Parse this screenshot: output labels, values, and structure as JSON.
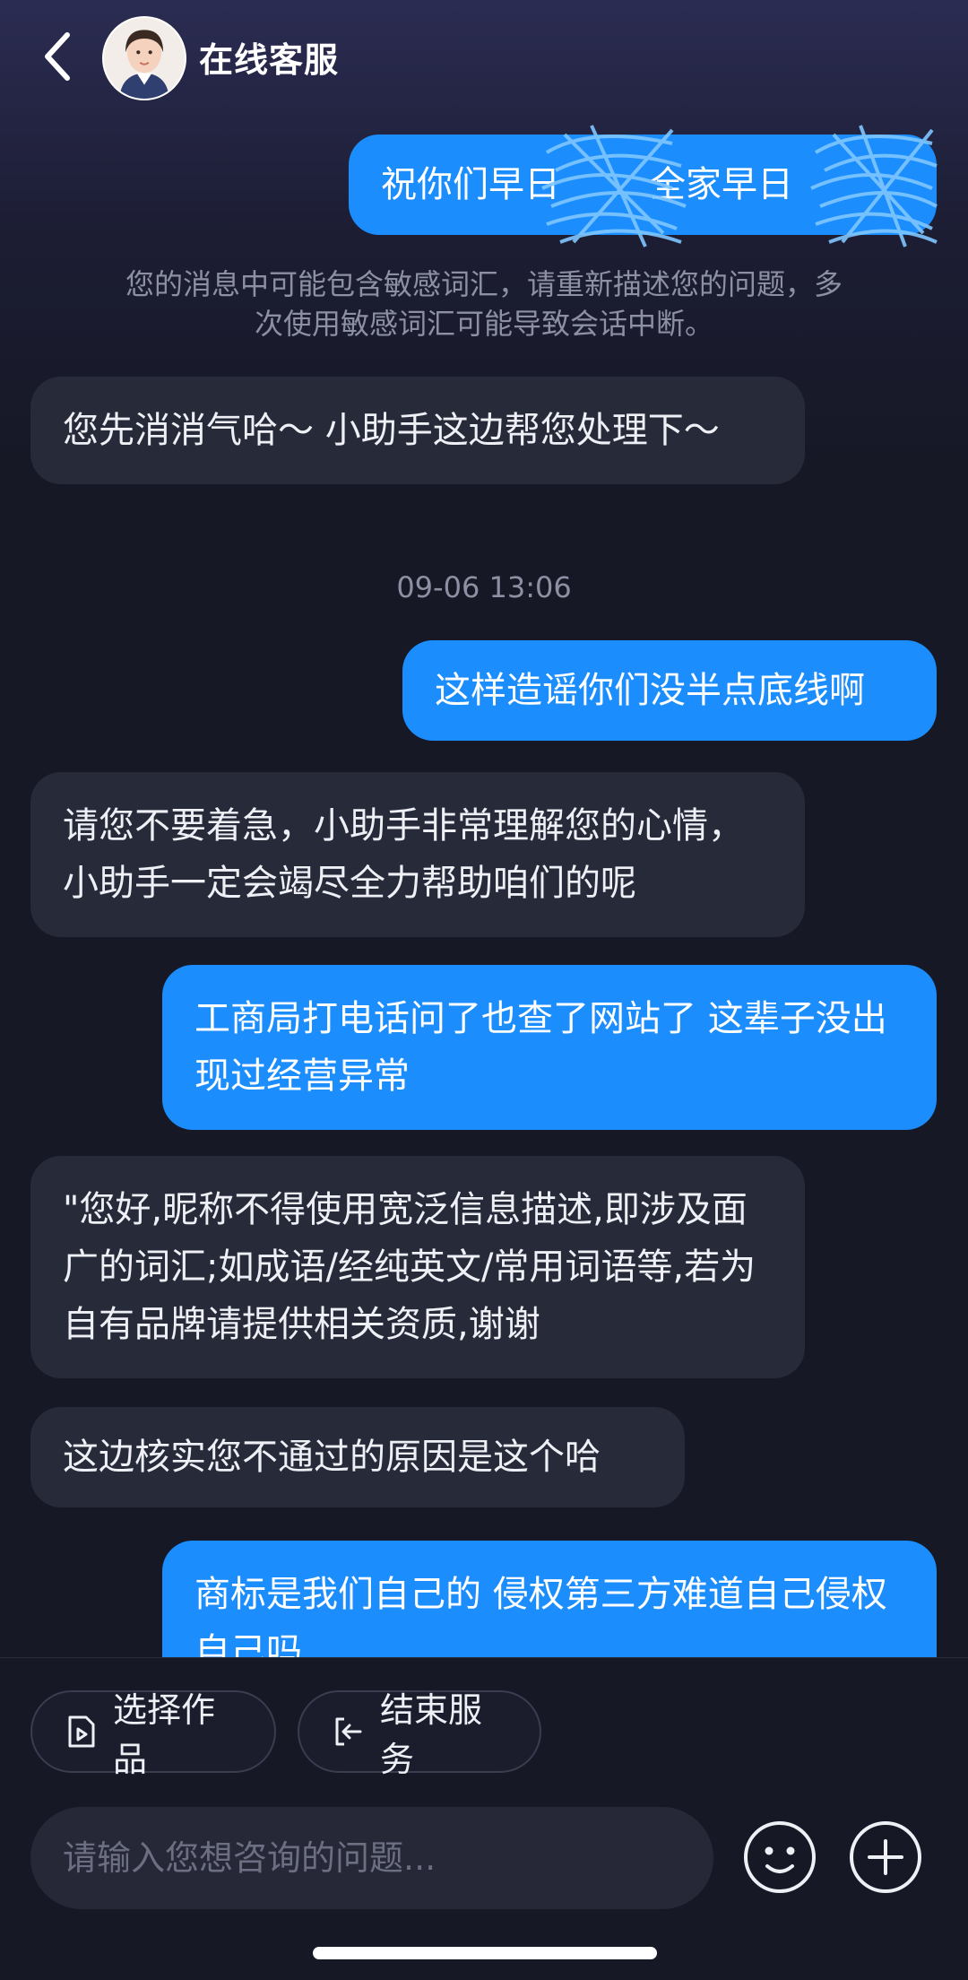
{
  "header": {
    "title": "在线客服"
  },
  "messages": {
    "m1": "祝你们早日",
    "m1b": "全家早日",
    "notice": "您的消息中可能包含敏感词汇，请重新描述您的问题，多次使用敏感词汇可能导致会话中断。",
    "m2": "您先消消气哈～ 小助手这边帮您处理下～",
    "timestamp": "09-06 13:06",
    "m3": "这样造谣你们没半点底线啊",
    "m4": "请您不要着急，小助手非常理解您的心情，小助手一定会竭尽全力帮助咱们的呢",
    "m5": "工商局打电话问了也查了网站了 这辈子没出现过经营异常",
    "m6": "\"您好,昵称不得使用宽泛信息描述,即涉及面广的词汇;如成语/经纯英文/常用词语等,若为自有品牌请提供相关资质,谢谢",
    "m7": "这边核实您不通过的原因是这个哈",
    "m8": "商标是我们自己的 侵权第三方难道自己侵权自己吗"
  },
  "actions": {
    "select_works": "选择作品",
    "end_service": "结束服务"
  },
  "input": {
    "placeholder": "请输入您想咨询的问题..."
  },
  "icons": {
    "back": "chevron-left-icon",
    "emoji": "smiley-icon",
    "add": "plus-circle-icon",
    "select_works": "video-file-icon",
    "end_service": "exit-icon"
  },
  "colors": {
    "outgoing_bubble": "#1b8dfc",
    "incoming_bubble": "#272a39",
    "background": "#161826"
  }
}
